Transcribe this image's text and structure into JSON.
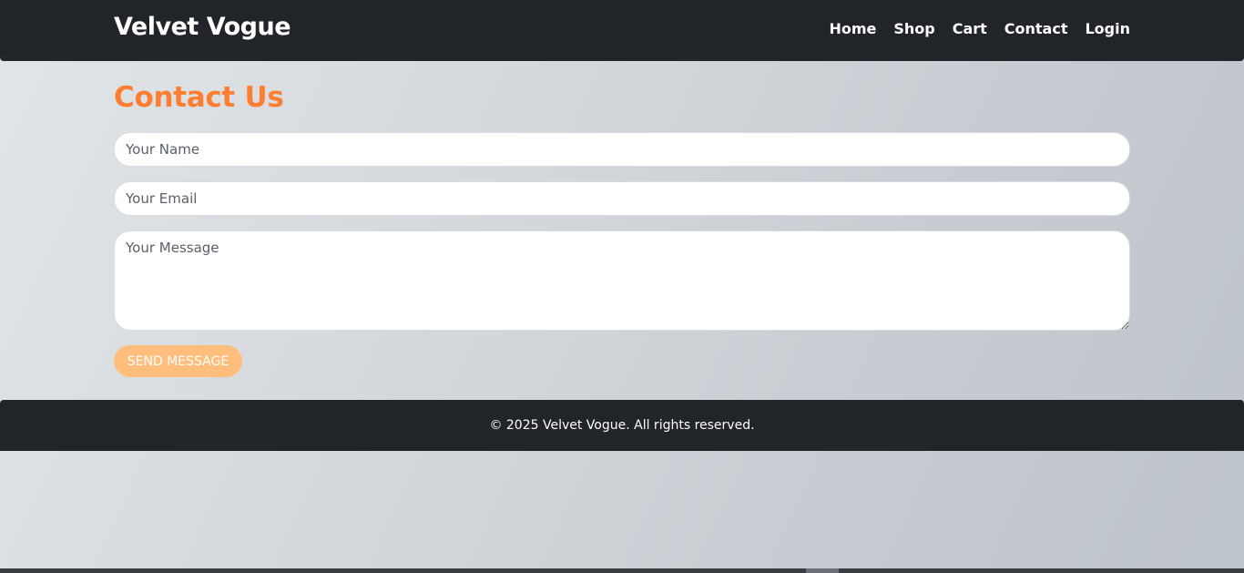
{
  "navbar": {
    "brand": "Velvet Vogue",
    "links": [
      "Home",
      "Shop",
      "Cart",
      "Contact",
      "Login"
    ]
  },
  "contact": {
    "title": "Contact Us",
    "name_placeholder": "Your Name",
    "email_placeholder": "Your Email",
    "message_placeholder": "Your Message",
    "send_label": "Send Message"
  },
  "footer": {
    "copyright": "© 2025 Velvet Vogue. All rights reserved."
  },
  "colors": {
    "accent": "#fd7e30",
    "button": "#ffbe7c",
    "dark": "#212429"
  }
}
